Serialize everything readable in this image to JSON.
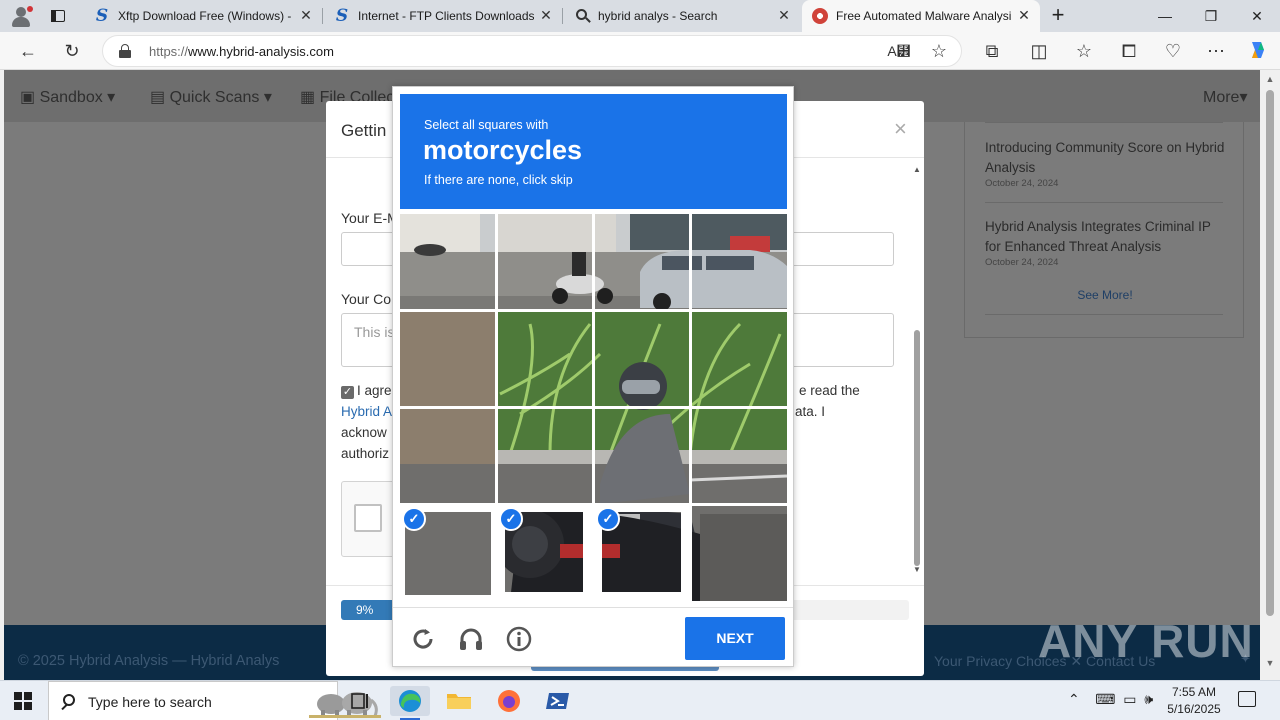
{
  "browser": {
    "tabs": [
      {
        "title": "Xftp Download Free (Windows) -",
        "icon": "s-site-icon"
      },
      {
        "title": "Internet - FTP Clients Downloads",
        "icon": "s-site-icon"
      },
      {
        "title": "hybrid analys - Search",
        "icon": "search-icon"
      },
      {
        "title": "Free Automated Malware Analysi",
        "icon": "hybrid-analysis-icon"
      }
    ],
    "url_prefix": "https://",
    "url_host": "www.hybrid-analysis.com",
    "url_rest": ""
  },
  "site": {
    "nav": [
      "Sandbox",
      "Quick Scans",
      "File Collec",
      "More"
    ],
    "news": [
      {
        "title": "Introducing Community Score on Hybrid Analysis",
        "date": "October 24, 2024"
      },
      {
        "title": "Hybrid Analysis Integrates Criminal IP for Enhanced Threat Analysis",
        "date": "October 24, 2024"
      }
    ],
    "see_more": "See More!",
    "footer_left": "© 2025 Hybrid Analysis — Hybrid Analys",
    "footer_right": "Your Privacy Choices  ✕  Contact Us"
  },
  "modal": {
    "title": "Gettin",
    "email_label": "Your E-M",
    "comment_label": "Your Co",
    "comment_placeholder": "This is",
    "agree_lines": [
      "I agre",
      "e read the",
      "Hybrid A",
      "ata. I",
      "acknow",
      "authoriz"
    ],
    "progress_label": "9%",
    "progress": 0.09
  },
  "captcha": {
    "line1": "Select all squares with",
    "target": "motorcycles",
    "line3": "If there are none, click skip",
    "next_label": "NEXT",
    "selected_tiles": [
      12,
      13,
      14
    ]
  },
  "watermark": "ANY RUN",
  "taskbar": {
    "search_placeholder": "Type here to search",
    "time": "7:55 AM",
    "date": "5/16/2025"
  },
  "colors": {
    "captcha_blue": "#1a73e8",
    "footer": "#0c2b45",
    "progress": "#337ab7"
  }
}
